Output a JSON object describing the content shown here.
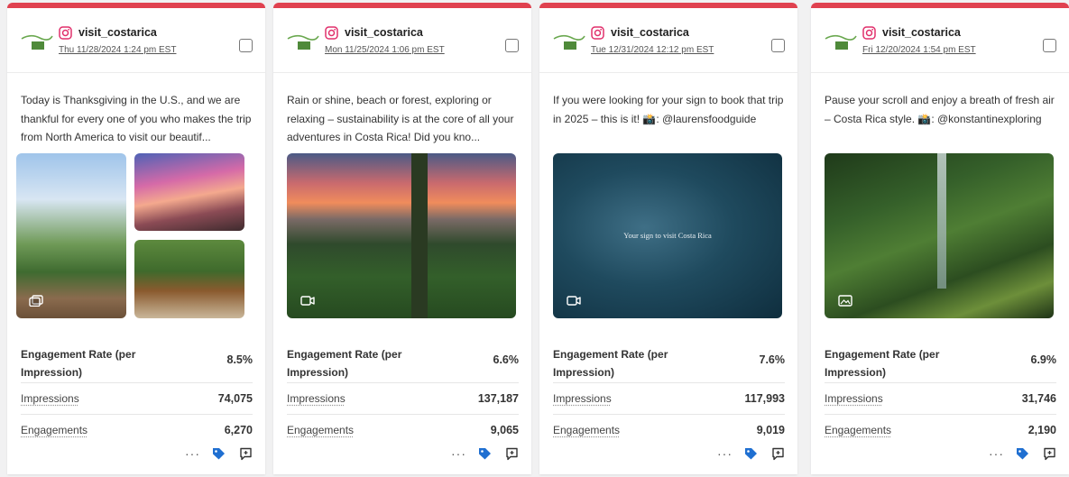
{
  "posts": [
    {
      "account": "visit_costarica",
      "date": "Thu 11/28/2024 1:24 pm EST",
      "caption": "Today is Thanksgiving in the U.S., and we are thankful for every one of you who makes the trip from North America to visit our beautif...",
      "media_type": "carousel",
      "media_icon": "carousel-icon",
      "metrics": {
        "engagement_rate_label": "Engagement Rate (per Impression)",
        "engagement_rate": "8.5%",
        "impressions_label": "Impressions",
        "impressions": "74,075",
        "engagements_label": "Engagements",
        "engagements": "6,270"
      }
    },
    {
      "account": "visit_costarica",
      "date": "Mon 11/25/2024 1:06 pm EST",
      "caption": "Rain or shine, beach or forest, exploring or relaxing – sustainability is at the core of all your adventures in Costa Rica! Did you kno...",
      "media_type": "video",
      "media_icon": "video-icon",
      "metrics": {
        "engagement_rate_label": "Engagement Rate (per Impression)",
        "engagement_rate": "6.6%",
        "impressions_label": "Impressions",
        "impressions": "137,187",
        "engagements_label": "Engagements",
        "engagements": "9,065"
      }
    },
    {
      "account": "visit_costarica",
      "date": "Tue 12/31/2024 12:12 pm EST",
      "caption": "If you were looking for your sign to book that trip in 2025 – this is it! 📸: @laurensfoodguide",
      "media_type": "video",
      "media_icon": "video-icon",
      "media_text": "Your sign to visit Costa Rica",
      "metrics": {
        "engagement_rate_label": "Engagement Rate (per Impression)",
        "engagement_rate": "7.6%",
        "impressions_label": "Impressions",
        "impressions": "117,993",
        "engagements_label": "Engagements",
        "engagements": "9,019"
      }
    },
    {
      "account": "visit_costarica",
      "date": "Fri 12/20/2024 1:54 pm EST",
      "caption": "Pause your scroll and enjoy a breath of fresh air – Costa Rica style. 📸: @konstantinexploring",
      "media_type": "image",
      "media_icon": "image-icon",
      "metrics": {
        "engagement_rate_label": "Engagement Rate (per Impression)",
        "engagement_rate": "6.9%",
        "impressions_label": "Impressions",
        "impressions": "31,746",
        "engagements_label": "Engagements",
        "engagements": "2,190"
      }
    }
  ],
  "actions": {
    "more_label": "···",
    "tag_icon": "tag-icon",
    "comment_icon": "comment-icon"
  },
  "colors": {
    "accent": "#e0414f",
    "instagram": "#e1306c",
    "tag": "#1f6fd1"
  }
}
